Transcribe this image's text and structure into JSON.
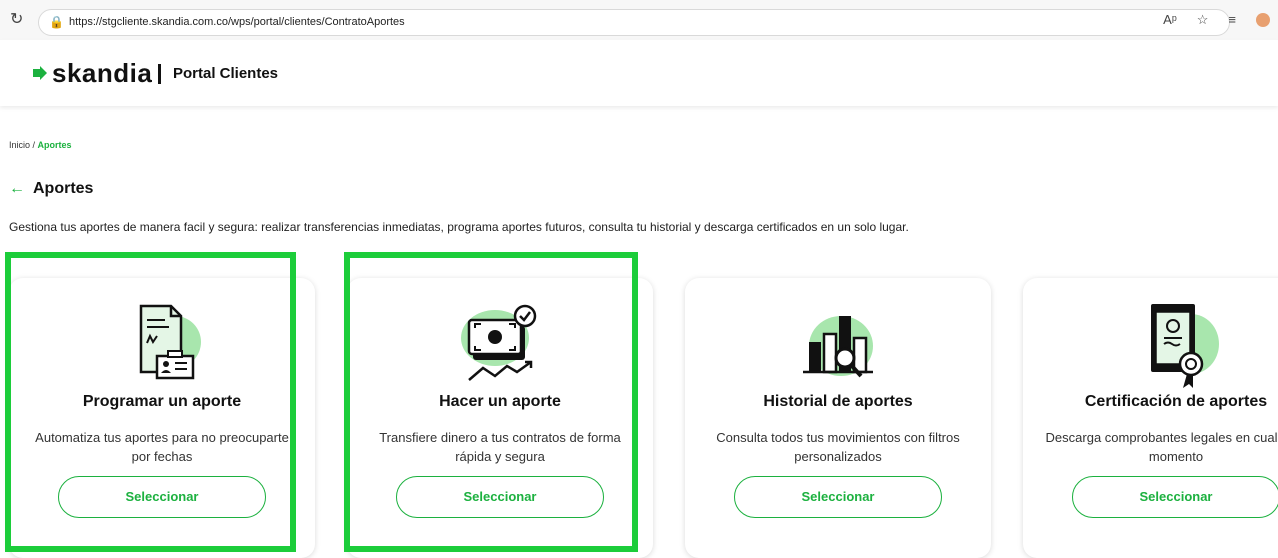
{
  "browser": {
    "url": "https://stgcliente.skandia.com.co/wps/portal/clientes/ContratoAportes"
  },
  "header": {
    "brand": "skandia",
    "portal_label": "Portal Clientes"
  },
  "breadcrumb": {
    "home": "Inicio /",
    "current": "Aportes"
  },
  "page": {
    "title": "Aportes",
    "description": "Gestiona tus aportes de manera facil y segura: realizar transferencias inmediatas, programa aportes futuros, consulta tu historial y descarga certificados en un solo lugar."
  },
  "cards": [
    {
      "title": "Programar un aporte",
      "text": "Automatiza tus aportes para no preocuparte por fechas",
      "button": "Seleccionar",
      "icon": "document-calendar-icon"
    },
    {
      "title": "Hacer un aporte",
      "text": "Transfiere dinero a tus contratos de forma rápida y segura",
      "button": "Seleccionar",
      "icon": "money-transfer-icon"
    },
    {
      "title": "Historial de aportes",
      "text": "Consulta todos tus movimientos con filtros personalizados",
      "button": "Seleccionar",
      "icon": "chart-magnifier-icon"
    },
    {
      "title": "Certificación de aportes",
      "text": "Descarga comprobantes legales en cualquier momento",
      "button": "Seleccionar",
      "icon": "certificate-icon"
    }
  ],
  "colors": {
    "accent": "#1cb13f",
    "highlight": "#1ccd3a",
    "blob": "#a8e6ad"
  }
}
